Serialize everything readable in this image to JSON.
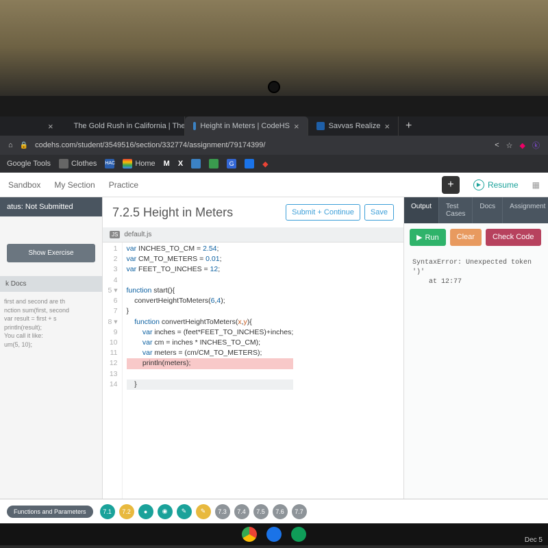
{
  "browser": {
    "tabs": [
      {
        "title": "The Gold Rush in California | The",
        "icon_color": "#2a8c3b",
        "active": false
      },
      {
        "title": "Height in Meters | CodeHS",
        "icon_color": "#3b82c4",
        "active": true
      },
      {
        "title": "Savvas Realize",
        "icon_color": "#1e5fa8",
        "active": false
      }
    ],
    "url": "codehs.com/student/3549516/section/332774/assignment/79174399/",
    "bookmarks": [
      "Google Tools",
      "Clothes",
      "HAC",
      "Home",
      "X"
    ]
  },
  "nav": {
    "items": [
      "Sandbox",
      "My Section",
      "Practice"
    ],
    "resume": "Resume"
  },
  "left": {
    "status": "atus: Not Submitted",
    "show_exercise": "Show Exercise",
    "docs_header": "k Docs",
    "docs_lines": [
      " first and second are th",
      "nction sum(first, second",
      "  var result = first + s",
      "  println(result);",
      "",
      "",
      " You call it like:",
      "um(5, 10);"
    ]
  },
  "lesson": {
    "title": "7.2.5 Height in Meters",
    "submit": "Submit + Continue",
    "save": "Save",
    "file": "default.js"
  },
  "code": {
    "lines": [
      "var INCHES_TO_CM = 2.54;",
      "var CM_TO_METERS = 0.01;",
      "var FEET_TO_INCHES = 12;",
      "",
      "function start(){",
      "    convertHeightToMeters(6,4);",
      "}",
      "    function convertHeightToMeters(x,y){",
      "        var inches = (feet*FEET_TO_INCHES)+inches;",
      "        var cm = inches * INCHES_TO_CM);",
      "        var meters = (cm/CM_TO_METERS);",
      "        println(meters);",
      "",
      "    }"
    ],
    "error_line_index": 11,
    "highlight_line_index": 13,
    "fold_lines": [
      4,
      7
    ]
  },
  "output": {
    "tabs": [
      "Output",
      "Test Cases",
      "Docs",
      "Assignment"
    ],
    "run": "Run",
    "clear": "Clear",
    "check": "Check Code",
    "console": "SyntaxError: Unexpected token ')'\n    at 12:77"
  },
  "footer": {
    "label": "Functions and Parameters",
    "dots": [
      {
        "label": "7.1",
        "class": "teal"
      },
      {
        "label": "7.2",
        "class": "yellow"
      },
      {
        "label": "●",
        "class": "teal"
      },
      {
        "label": "◉",
        "class": "teal"
      },
      {
        "label": "✎",
        "class": "teal"
      },
      {
        "label": "✎",
        "class": "yellow"
      },
      {
        "label": "7.3",
        "class": "gray"
      },
      {
        "label": "7.4",
        "class": "gray"
      },
      {
        "label": "7.5",
        "class": "gray"
      },
      {
        "label": "7.6",
        "class": "gray"
      },
      {
        "label": "7.7",
        "class": "gray"
      }
    ]
  },
  "taskbar": {
    "date": "Dec 5"
  }
}
